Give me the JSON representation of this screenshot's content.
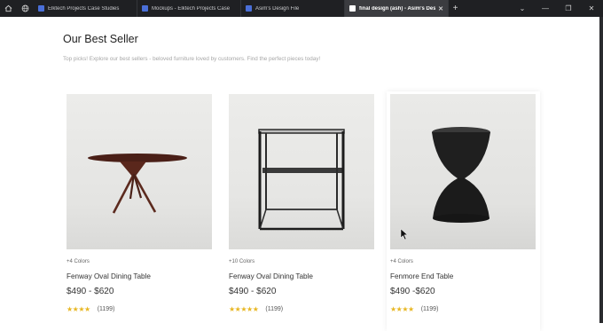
{
  "browser": {
    "tabs": [
      {
        "label": "Elktech Projects Case Studies",
        "active": false
      },
      {
        "label": "Mockups - Elktech Projects Case",
        "active": false
      },
      {
        "label": "Asim's Design File",
        "active": false
      },
      {
        "label": "final design (ash) - Asim's Design",
        "active": true
      }
    ],
    "colors": {
      "chrome": "#1f2023",
      "active_tab": "#3b3c40",
      "favicon": "#4a6fd8"
    }
  },
  "section": {
    "title": "Our Best Seller",
    "subtitle": "Top picks! Explore our best sellers - beloved furniture loved by customers. Find the perfect pieces today!"
  },
  "products": [
    {
      "colors": "+4 Colors",
      "name": "Fenway Oval Dining Table",
      "price": "$490 - $620",
      "rating": 4,
      "reviews": "(1199)",
      "image": "oval-dining-table"
    },
    {
      "colors": "+10 Colors",
      "name": "Fenway Oval Dining Table",
      "price": "$490 - $620",
      "rating": 5,
      "reviews": "(1199)",
      "image": "glass-side-table"
    },
    {
      "colors": "+4 Colors",
      "name": "Fenmore End Table",
      "price": "$490 -$620",
      "rating": 4,
      "reviews": "(1199)",
      "image": "hourglass-end-table"
    }
  ],
  "accent": {
    "stars": "#e8b723"
  }
}
